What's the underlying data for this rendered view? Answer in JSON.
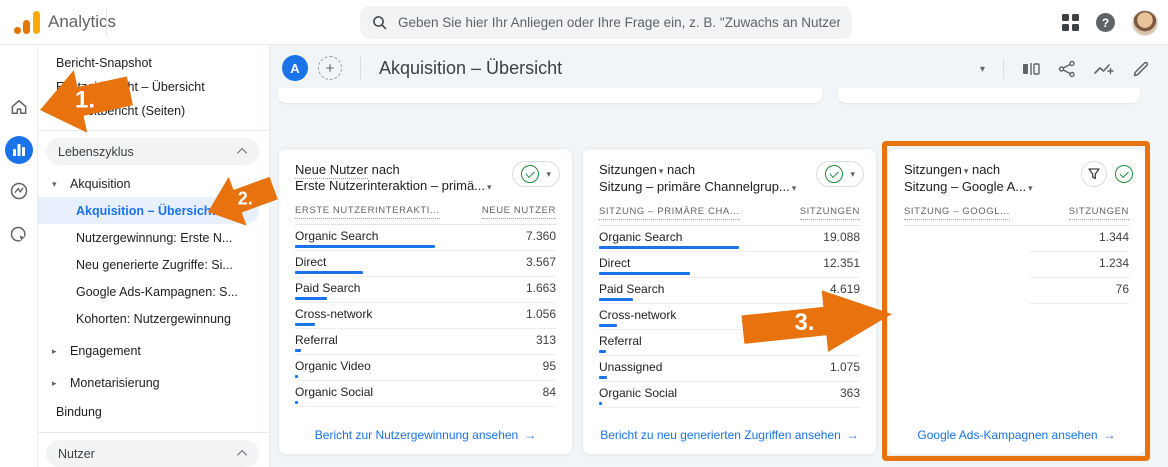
{
  "colors": {
    "accent_blue": "#1a73e8",
    "annotation_orange": "#e8720d",
    "success_green": "#1e8e3e"
  },
  "topbar": {
    "app_name": "Analytics",
    "search_placeholder": "Geben Sie hier Ihr Anliegen oder Ihre Frage ein, z. B. \"Zuwachs an Nutzern...\""
  },
  "icons": {
    "arrow_right": "→",
    "caret_down": "▾",
    "caret_right": "▸",
    "plus": "+",
    "help": "?"
  },
  "sidebar": {
    "top_items": {
      "snapshot": "Bericht-Snapshot",
      "realtime_overview": "Echtzeitbericht – Übersicht",
      "realtime_pages": "Echtzeitbericht (Seiten)"
    },
    "section_lifecycle": "Lebenszyklus",
    "acquisition_parent": "Akquisition",
    "acquisition_children": {
      "overview": "Akquisition – Übersicht",
      "user_acq": "Nutzergewinnung: Erste N...",
      "traffic_acq": "Neu generierte Zugriffe: Si...",
      "google_ads": "Google Ads-Kampagnen: S...",
      "cohorts": "Kohorten: Nutzergewinnung"
    },
    "engagement": "Engagement",
    "monetization": "Monetarisierung",
    "retention": "Bindung",
    "section_user": "Nutzer"
  },
  "header": {
    "avatar_letter": "A",
    "title": "Akquisition – Übersicht"
  },
  "cards": [
    {
      "metric": "Neue Nutzer",
      "title_suffix": " nach",
      "dimension": "Erste Nutzerinteraktion – primä...",
      "col_dim": "ERSTE NUTZERINTERAKTI...",
      "col_val": "NEUE NUTZER",
      "rows": [
        {
          "label": "Organic Search",
          "value": "7.360",
          "bar": 140
        },
        {
          "label": "Direct",
          "value": "3.567",
          "bar": 68
        },
        {
          "label": "Paid Search",
          "value": "1.663",
          "bar": 32
        },
        {
          "label": "Cross-network",
          "value": "1.056",
          "bar": 20
        },
        {
          "label": "Referral",
          "value": "313",
          "bar": 6
        },
        {
          "label": "Organic Video",
          "value": "95",
          "bar": 3
        },
        {
          "label": "Organic Social",
          "value": "84",
          "bar": 3
        }
      ],
      "footer": "Bericht zur Nutzergewinnung ansehen"
    },
    {
      "metric": "Sitzungen",
      "title_suffix": " nach",
      "dimension": "Sitzung – primäre Channelgrup...",
      "col_dim": "SITZUNG – PRIMÄRE CHA...",
      "col_val": "SITZUNGEN",
      "rows": [
        {
          "label": "Organic Search",
          "value": "19.088",
          "bar": 140
        },
        {
          "label": "Direct",
          "value": "12.351",
          "bar": 91
        },
        {
          "label": "Paid Search",
          "value": "4.619",
          "bar": 34
        },
        {
          "label": "Cross-network",
          "value": "",
          "bar": 18
        },
        {
          "label": "Referral",
          "value": "",
          "bar": 7
        },
        {
          "label": "Unassigned",
          "value": "1.075",
          "bar": 8
        },
        {
          "label": "Organic Social",
          "value": "363",
          "bar": 3
        }
      ],
      "footer": "Bericht zu neu generierten Zugriffen ansehen"
    },
    {
      "metric": "Sitzungen",
      "title_suffix": " nach",
      "dimension": "Sitzung – Google A...",
      "col_dim": "SITZUNG – GOOGL...",
      "col_val": "SITZUNGEN",
      "rows": [
        {
          "label": "",
          "value": "1.344",
          "bar": 0
        },
        {
          "label": "",
          "value": "1.234",
          "bar": 0
        },
        {
          "label": "",
          "value": "76",
          "bar": 0
        }
      ],
      "footer": "Google Ads-Kampagnen ansehen"
    }
  ],
  "annotations": {
    "step1": "1.",
    "step2": "2.",
    "step3": "3."
  }
}
